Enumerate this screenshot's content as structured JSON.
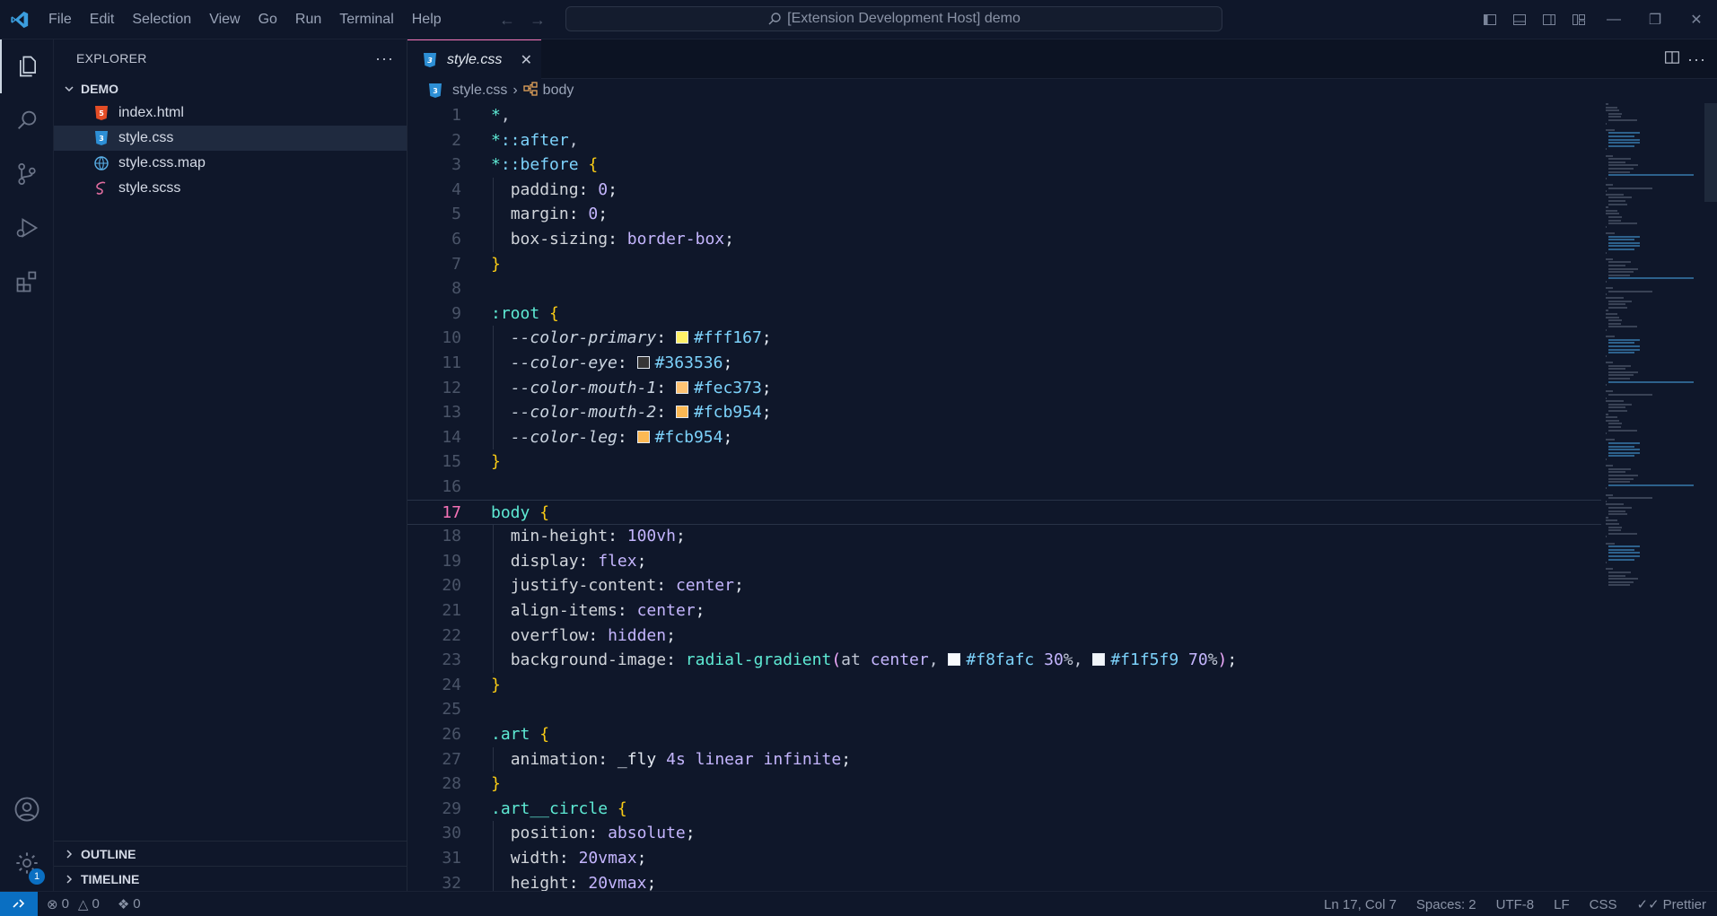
{
  "menu": [
    "File",
    "Edit",
    "Selection",
    "View",
    "Go",
    "Run",
    "Terminal",
    "Help"
  ],
  "command_center": {
    "text": "[Extension Development Host] demo"
  },
  "activity": {
    "settings_badge": "1"
  },
  "sidebar": {
    "title": "EXPLORER",
    "folder": "DEMO",
    "files": [
      {
        "name": "index.html",
        "icon": "html-file-icon"
      },
      {
        "name": "style.css",
        "icon": "css-file-icon"
      },
      {
        "name": "style.css.map",
        "icon": "map-file-icon"
      },
      {
        "name": "style.scss",
        "icon": "scss-file-icon"
      }
    ],
    "outline": "OUTLINE",
    "timeline": "TIMELINE"
  },
  "editor": {
    "tab": "style.css",
    "breadcrumb_file": "style.css",
    "breadcrumb_symbol": "body",
    "current_line": 17,
    "lines": [
      "*,",
      "*::after,",
      "*::before {",
      "  padding: 0;",
      "  margin: 0;",
      "  box-sizing: border-box;",
      "}",
      "",
      ":root {",
      "  --color-primary: #fff167;",
      "  --color-eye: #363536;",
      "  --color-mouth-1: #fec373;",
      "  --color-mouth-2: #fcb954;",
      "  --color-leg: #fcb954;",
      "}",
      "",
      "body {",
      "  min-height: 100vh;",
      "  display: flex;",
      "  justify-content: center;",
      "  align-items: center;",
      "  overflow: hidden;",
      "  background-image: radial-gradient(at center, #f8fafc 30%, #f1f5f9 70%);",
      "}",
      "",
      ".art {",
      "  animation: _fly 4s linear infinite;",
      "}",
      ".art__circle {",
      "  position: absolute;",
      "  width: 20vmax;",
      "  height: 20vmax;"
    ]
  },
  "status": {
    "errors": "0",
    "warnings": "0",
    "ports": "0",
    "position": "Ln 17, Col 7",
    "spaces": "Spaces: 2",
    "encoding": "UTF-8",
    "eol": "LF",
    "language": "CSS",
    "formatter": "Prettier"
  },
  "colors": {
    "accent_tab": "#f472b6",
    "remote": "#0a6fc2",
    "swatch_primary": "#fff167",
    "swatch_eye": "#363536",
    "swatch_mouth_1": "#fec373",
    "swatch_mouth_2": "#fcb954",
    "swatch_leg": "#fcb954",
    "swatch_grad_1": "#f8fafc",
    "swatch_grad_2": "#f1f5f9"
  }
}
